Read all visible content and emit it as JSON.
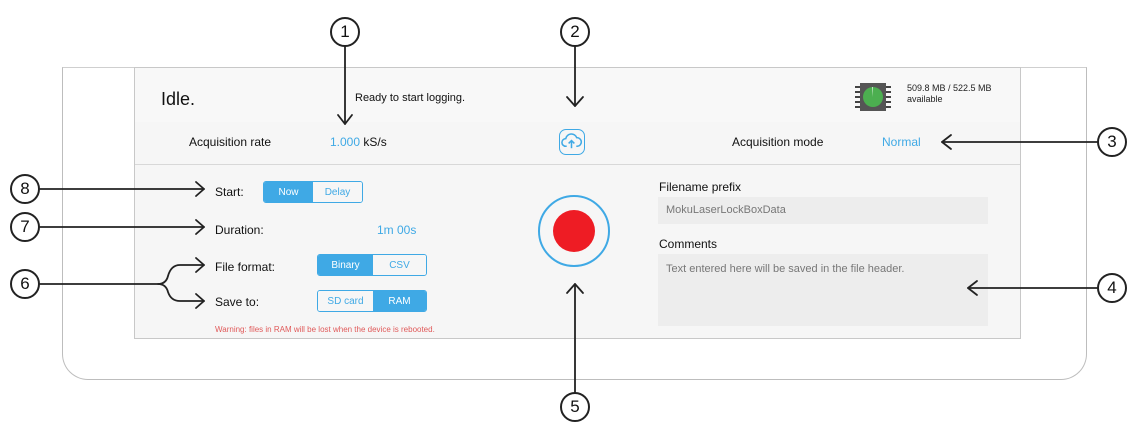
{
  "status": {
    "title": "Idle.",
    "message": "Ready to start logging.",
    "memory_line1": "509.8 MB / 522.5 MB",
    "memory_line2": "available",
    "memory_icon": "memory-chip-icon",
    "memory_used_fraction": 0.98
  },
  "acquisition": {
    "rate_label": "Acquisition rate",
    "rate_value": "1.000",
    "rate_unit": "kS/s",
    "upload_icon": "cloud-upload-icon",
    "mode_label": "Acquisition mode",
    "mode_value": "Normal"
  },
  "settings": {
    "start_label": "Start:",
    "start_options": [
      "Now",
      "Delay"
    ],
    "start_selected": "Now",
    "duration_label": "Duration:",
    "duration_value": "1m 00s",
    "file_format_label": "File format:",
    "file_format_options": [
      "Binary",
      "CSV"
    ],
    "file_format_selected": "Binary",
    "save_to_label": "Save to:",
    "save_to_options": [
      "SD card",
      "RAM"
    ],
    "save_to_selected": "RAM",
    "warning": "Warning: files in RAM will be lost when the device is rebooted."
  },
  "record": {
    "icon": "record-icon"
  },
  "fields": {
    "filename_label": "Filename prefix",
    "filename_value": "MokuLaserLockBoxData",
    "comments_label": "Comments",
    "comments_placeholder": "Text entered here will be saved in the file header."
  },
  "callouts": [
    "1",
    "2",
    "3",
    "4",
    "5",
    "6",
    "7",
    "8"
  ],
  "colors": {
    "accent": "#3fa9e5",
    "record": "#ee1c24",
    "warning": "#e05a5a",
    "memory": "#4caf50"
  }
}
